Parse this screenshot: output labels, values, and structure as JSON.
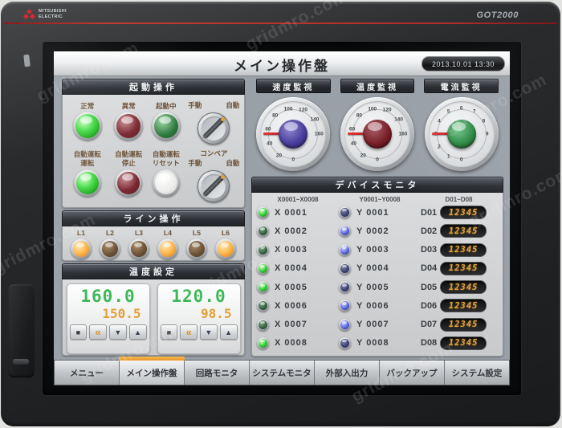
{
  "brand": {
    "line1": "MITSUBISHI",
    "line2": "ELECTRIC",
    "model": "GOT2000",
    "logo_color": "#cf2a33"
  },
  "watermark": "gridmro.com",
  "header": {
    "title": "メイン操作盤",
    "timestamp": "2013.10.01 13:30"
  },
  "startup": {
    "title": "起動操作",
    "cells": [
      {
        "type": "lamp",
        "lines": [
          "正常"
        ],
        "state": "green-on"
      },
      {
        "type": "lamp",
        "lines": [
          "異常"
        ],
        "state": "red-off"
      },
      {
        "type": "lamp",
        "lines": [
          "起動中"
        ],
        "state": "green-dim"
      },
      {
        "type": "switch",
        "lines": [],
        "left": "手動",
        "right": "自動"
      },
      {
        "type": "lamp",
        "lines": [
          "自動運転",
          "運転"
        ],
        "state": "green-on"
      },
      {
        "type": "lamp",
        "lines": [
          "自動運転",
          "停止"
        ],
        "state": "red-off"
      },
      {
        "type": "lamp",
        "lines": [
          "自動運転",
          "リセット"
        ],
        "state": "white"
      },
      {
        "type": "switch",
        "lines": [
          "コンベア"
        ],
        "left": "手動",
        "right": "自動"
      }
    ]
  },
  "line": {
    "title": "ライン操作",
    "lamps": [
      {
        "label": "L1",
        "on": true
      },
      {
        "label": "L2",
        "on": false
      },
      {
        "label": "L3",
        "on": false
      },
      {
        "label": "L4",
        "on": true
      },
      {
        "label": "L5",
        "on": false
      },
      {
        "label": "L6",
        "on": true
      }
    ]
  },
  "temp": {
    "title": "温度設定",
    "buttons": [
      "■",
      "«",
      "▼",
      "▲"
    ],
    "button_names": [
      "stop-button",
      "shift-button",
      "down-button",
      "up-button"
    ],
    "controllers": [
      {
        "pv": "160.0",
        "sv": "150.5"
      },
      {
        "pv": "120.0",
        "sv": "98.5"
      }
    ],
    "pv_color": "#3db858",
    "sv_color": "#e2a138"
  },
  "gauges": [
    {
      "title": "速度監視",
      "scale": [
        "0",
        "20",
        "40",
        "60",
        "80",
        "100",
        "120",
        "140",
        "160"
      ],
      "dome": "blue",
      "dome_color": "#4a3f9e",
      "needle_color": "#c62828"
    },
    {
      "title": "温度監視",
      "scale": [
        "0",
        "20",
        "40",
        "60",
        "80",
        "100",
        "120",
        "140",
        "160"
      ],
      "dome": "red",
      "dome_color": "#7a2028",
      "needle_color": "#c62828"
    },
    {
      "title": "電流監視",
      "scale": [
        "0",
        "1",
        "2",
        "3",
        "4",
        "5",
        "6",
        "7",
        "8",
        "9"
      ],
      "dome": "green",
      "dome_color": "#2e8b45",
      "needle_color": "#c62828"
    }
  ],
  "monitor": {
    "title": "デバイスモニタ",
    "col_headers": [
      "X0001~X0008",
      "Y0001~Y0008",
      "D01~D08"
    ],
    "value_color": "#e2a33c",
    "rows": [
      {
        "x": "X 0001",
        "x_on": true,
        "y": "Y 0001",
        "y_on": false,
        "d": "D01",
        "value": "12345"
      },
      {
        "x": "X 0002",
        "x_on": false,
        "y": "Y 0002",
        "y_on": true,
        "d": "D02",
        "value": "12345"
      },
      {
        "x": "X 0003",
        "x_on": false,
        "y": "Y 0003",
        "y_on": true,
        "d": "D03",
        "value": "12345"
      },
      {
        "x": "X 0004",
        "x_on": true,
        "y": "Y 0004",
        "y_on": false,
        "d": "D04",
        "value": "12345"
      },
      {
        "x": "X 0005",
        "x_on": true,
        "y": "Y 0005",
        "y_on": false,
        "d": "D05",
        "value": "12345"
      },
      {
        "x": "X 0006",
        "x_on": false,
        "y": "Y 0006",
        "y_on": true,
        "d": "D06",
        "value": "12345"
      },
      {
        "x": "X 0007",
        "x_on": false,
        "y": "Y 0007",
        "y_on": true,
        "d": "D07",
        "value": "12345"
      },
      {
        "x": "X 0008",
        "x_on": true,
        "y": "Y 0008",
        "y_on": false,
        "d": "D08",
        "value": "12345"
      }
    ]
  },
  "menu": {
    "active_color": "#eda63a",
    "tabs": [
      {
        "label": "メニュー",
        "active": false
      },
      {
        "label": "メイン操作盤",
        "active": true
      },
      {
        "label": "回路モニタ",
        "active": false
      },
      {
        "label": "システムモニタ",
        "active": false
      },
      {
        "label": "外部入出力",
        "active": false
      },
      {
        "label": "バックアップ",
        "active": false
      },
      {
        "label": "システム設定",
        "active": false
      }
    ]
  }
}
